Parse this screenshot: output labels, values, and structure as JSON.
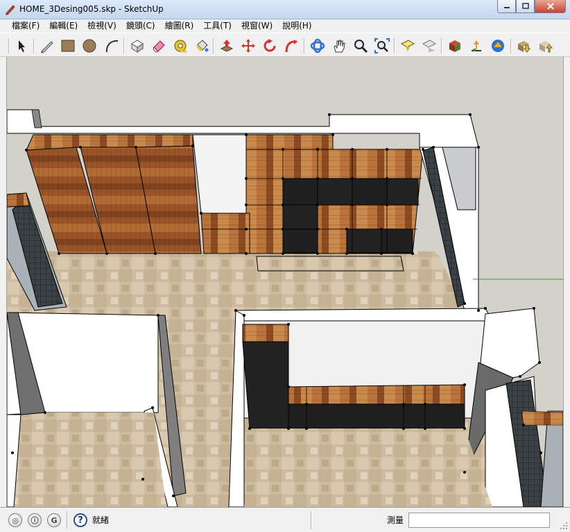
{
  "window": {
    "title": "HOME_3Desing005.skp - SketchUp"
  },
  "menu": [
    {
      "label": "檔案(F)"
    },
    {
      "label": "編輯(E)"
    },
    {
      "label": "檢視(V)"
    },
    {
      "label": "鏡頭(C)"
    },
    {
      "label": "繪圖(R)"
    },
    {
      "label": "工具(T)"
    },
    {
      "label": "視窗(W)"
    },
    {
      "label": "說明(H)"
    }
  ],
  "toolbar": {
    "tools": [
      "select-icon",
      "pencil-icon",
      "rectangle-icon",
      "circle-icon",
      "arc-icon",
      "make-component-icon",
      "eraser-icon",
      "tape-measure-icon",
      "paint-bucket-icon",
      "push-pull-icon",
      "move-icon",
      "rotate-icon",
      "follow-me-icon",
      "orbit-icon",
      "pan-icon",
      "zoom-icon",
      "zoom-extents-icon",
      "previous-view-icon",
      "next-view-icon",
      "3d-warehouse-icon",
      "share-model-icon",
      "geo-location-icon",
      "get-models-icon",
      "share-component-icon"
    ]
  },
  "status": {
    "icons": [
      "geo-icon",
      "credit-icon",
      "google-icon"
    ],
    "text": "就緒",
    "measure_label": "測量",
    "measure_value": ""
  },
  "colors": {
    "titlebar": "#c4d7ee",
    "chrome": "#f0f0f0",
    "wood": "#a0592a",
    "floor": "#cdbb9f",
    "background": "#d6d5cd",
    "cabinet_dark": "#202020"
  }
}
